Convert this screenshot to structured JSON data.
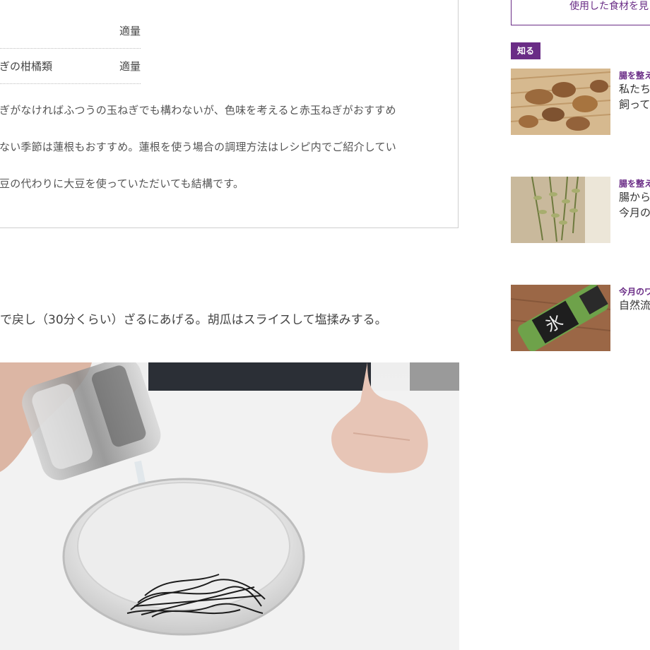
{
  "ingredients": [
    {
      "name": "",
      "amount": "適量"
    },
    {
      "name": "ぎの柑橘類",
      "amount": "適量"
    }
  ],
  "notes": [
    "ぎがなければふつうの玉ねぎでも構わないが、色味を考えると赤玉ねぎがおすすめ",
    "ない季節は蓮根もおすすめ。蓮根を使う場合の調理方法はレシピ内でご紹介してい",
    "豆の代わりに大豆を使っていただいても結構です。"
  ],
  "step": {
    "text": "で戻し（30分くらい）ざるにあげる。胡瓜はスライスして塩揉みする。"
  },
  "sidebar": {
    "ingredients_button": "使用した食材を見",
    "category_label": "知る",
    "cards": [
      {
        "category": "腸を整え",
        "title": "私たち\n飼って",
        "thumb_icon": "root-vegetables-photo"
      },
      {
        "category": "腸を整え",
        "title": "腸から\n今月の",
        "thumb_icon": "dried-grass-photo"
      },
      {
        "category": "今月のワ",
        "title": "自然流",
        "thumb_icon": "sake-bottle-photo"
      }
    ]
  },
  "colors": {
    "accent": "#6a2c86",
    "border": "#cfcfcf"
  }
}
